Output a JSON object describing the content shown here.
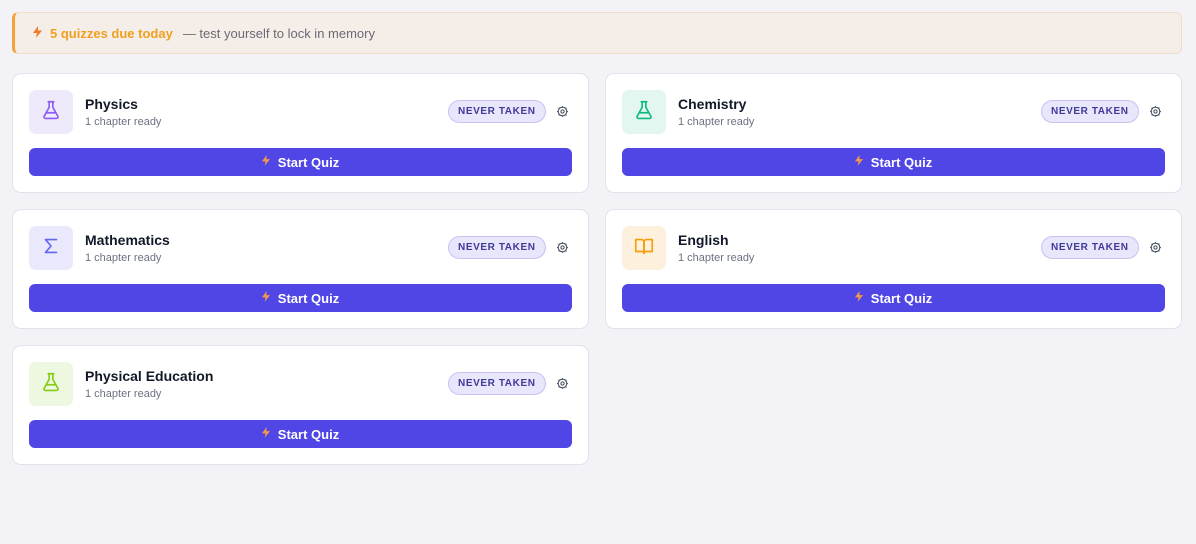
{
  "banner": {
    "bolt_icon": "lightning-icon",
    "due_text": "5 quizzes due today",
    "sub_text": "— test yourself to lock in memory",
    "accent": "#f2a33a"
  },
  "cards": [
    {
      "title": "Physics",
      "subtitle": "1 chapter ready",
      "badge": "NEVER TAKEN",
      "button": "Start Quiz",
      "icon": "flask-icon",
      "icon_color": "#8b5cf6",
      "icon_bg": "#efe9fc"
    },
    {
      "title": "Chemistry",
      "subtitle": "1 chapter ready",
      "badge": "NEVER TAKEN",
      "button": "Start Quiz",
      "icon": "flask-icon",
      "icon_color": "#10b981",
      "icon_bg": "#e3f6ef"
    },
    {
      "title": "Mathematics",
      "subtitle": "1 chapter ready",
      "badge": "NEVER TAKEN",
      "button": "Start Quiz",
      "icon": "sigma-icon",
      "icon_color": "#6366f1",
      "icon_bg": "#e9e9fb"
    },
    {
      "title": "English",
      "subtitle": "1 chapter ready",
      "badge": "NEVER TAKEN",
      "button": "Start Quiz",
      "icon": "book-icon",
      "icon_color": "#f59e0b",
      "icon_bg": "#fdf0dc"
    },
    {
      "title": "Physical Education",
      "subtitle": "1 chapter ready",
      "badge": "NEVER TAKEN",
      "button": "Start Quiz",
      "icon": "flask-icon",
      "icon_color": "#84cc16",
      "icon_bg": "#eef7df"
    }
  ],
  "colors": {
    "button": "#4f46e5",
    "badge_bg": "#e7e6fb",
    "badge_text": "#3f3a96"
  }
}
